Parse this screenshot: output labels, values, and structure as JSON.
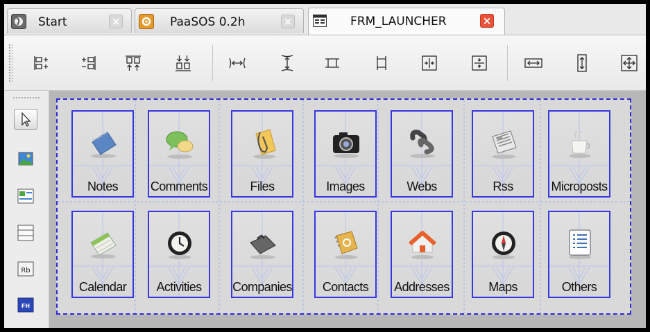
{
  "tabs": [
    {
      "label": "Start",
      "icon": "start-icon",
      "close": "×"
    },
    {
      "label": "PaaSOS 0.2h",
      "icon": "paasos-icon",
      "close": "×"
    },
    {
      "label": "FRM_LAUNCHER",
      "icon": "form-icon",
      "close": "×",
      "active": true
    }
  ],
  "toolbar": {
    "buttons": [
      "align-left-icon",
      "align-right-icon",
      "align-top-icon",
      "align-bottom-icon",
      "space-horizontal-icon",
      "space-vertical-icon",
      "same-width-icon",
      "same-height-icon",
      "center-horizontal-icon",
      "center-vertical-icon",
      "resize-width-icon",
      "resize-height-icon",
      "resize-both-icon"
    ]
  },
  "palette": {
    "tools": [
      "pointer-icon",
      "image-icon",
      "image-label-icon",
      "panel-icon",
      "label-icon",
      "field-icon"
    ],
    "label_text": "Rb",
    "field_text": "FH"
  },
  "launcher": {
    "items": [
      {
        "label": "Notes",
        "icon": "notes-icon"
      },
      {
        "label": "Comments",
        "icon": "comments-icon"
      },
      {
        "label": "Files",
        "icon": "files-icon"
      },
      {
        "label": "Images",
        "icon": "camera-icon"
      },
      {
        "label": "Webs",
        "icon": "link-icon"
      },
      {
        "label": "Rss",
        "icon": "newspaper-icon"
      },
      {
        "label": "Microposts",
        "icon": "cup-icon"
      },
      {
        "label": "Calendar",
        "icon": "calendar-icon"
      },
      {
        "label": "Activities",
        "icon": "clock-icon"
      },
      {
        "label": "Companies",
        "icon": "briefcase-icon"
      },
      {
        "label": "Contacts",
        "icon": "address-book-icon"
      },
      {
        "label": "Addresses",
        "icon": "house-icon"
      },
      {
        "label": "Maps",
        "icon": "compass-icon"
      },
      {
        "label": "Others",
        "icon": "list-icon"
      }
    ]
  },
  "colors": {
    "selection_border": "#3737e0",
    "close_active": "#e8533a",
    "canvas_bg": "#b7b7b7"
  }
}
